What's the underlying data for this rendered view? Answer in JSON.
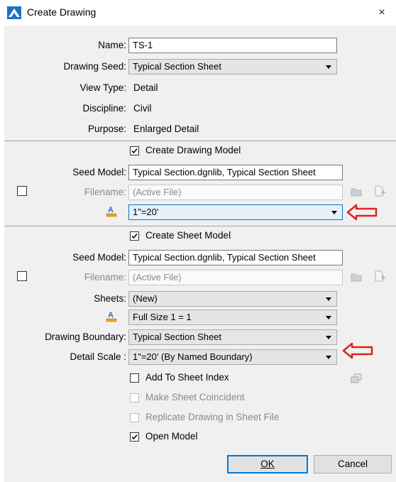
{
  "window": {
    "title": "Create Drawing",
    "close_glyph": "×"
  },
  "top": {
    "name_label": "Name:",
    "name_value": "TS-1",
    "seed_label": "Drawing Seed:",
    "seed_value": "Typical Section Sheet",
    "viewtype_label": "View Type:",
    "viewtype_value": "Detail",
    "discipline_label": "Discipline:",
    "discipline_value": "Civil",
    "purpose_label": "Purpose:",
    "purpose_value": "Enlarged Detail"
  },
  "drawing_model": {
    "create_label": "Create Drawing Model",
    "create_checked": true,
    "seed_label": "Seed Model:",
    "seed_value": "Typical Section.dgnlib, Typical Section Sheet",
    "filename_checked": false,
    "filename_label": "Filename:",
    "filename_placeholder": "(Active File)",
    "annotation_scale_value": "1\"=20'"
  },
  "sheet_model": {
    "create_label": "Create Sheet Model",
    "create_checked": true,
    "seed_label": "Seed Model:",
    "seed_value": "Typical Section.dgnlib, Typical Section Sheet",
    "filename_checked": false,
    "filename_label": "Filename:",
    "filename_placeholder": "(Active File)",
    "sheets_label": "Sheets:",
    "sheets_value": "(New)",
    "annotation_scale_value": "Full Size 1 = 1",
    "boundary_label": "Drawing Boundary:",
    "boundary_value": "Typical Section Sheet",
    "detail_scale_label": "Detail Scale :",
    "detail_scale_value": "1\"=20' (By Named Boundary)",
    "add_index_label": "Add To Sheet Index",
    "add_index_checked": false,
    "coincident_label": "Make Sheet Coincident",
    "replicate_label": "Replicate Drawing in Sheet File",
    "open_model_label": "Open Model",
    "open_model_checked": true
  },
  "buttons": {
    "ok_label": "OK",
    "cancel_label": "Cancel"
  },
  "icons": {
    "app": "drawing-app-icon",
    "annotation_scale": "annotation-scale-icon",
    "folder": "folder-icon",
    "new_file": "new-file-icon",
    "sheet_index": "sheet-index-icon",
    "annotation_arrow": "red-arrow-icon"
  },
  "colors": {
    "accent": "#0078d7",
    "annotation_arrow": "#e02020",
    "dialog_bg": "#f0f0f0"
  }
}
